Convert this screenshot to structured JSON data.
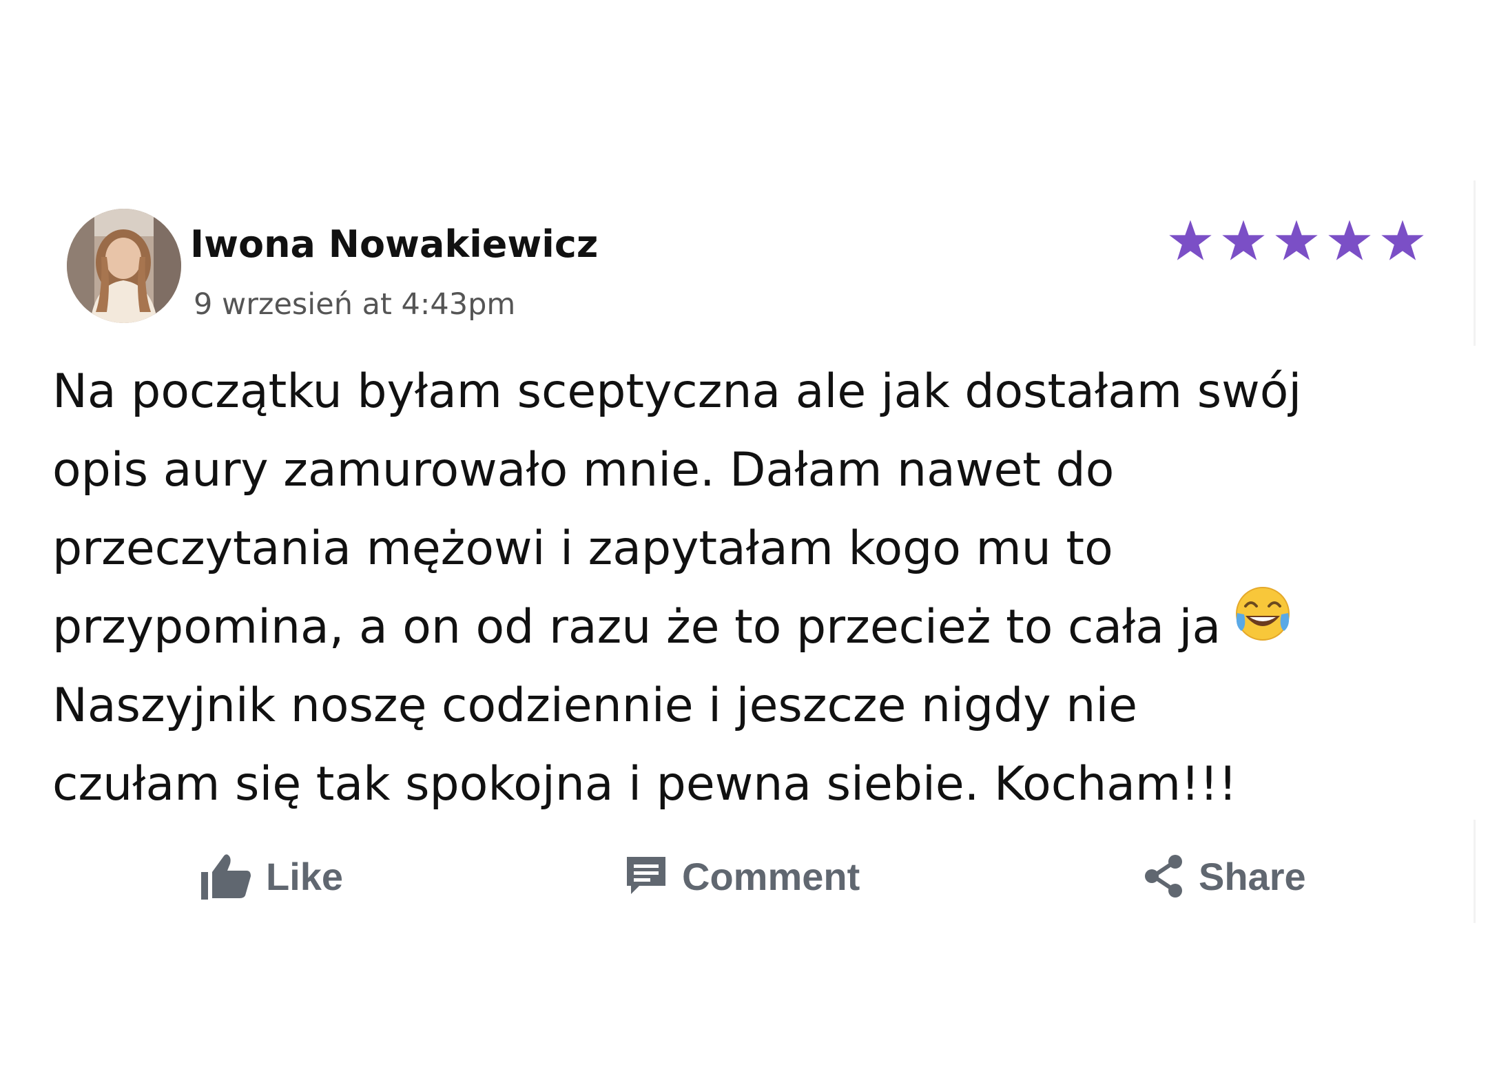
{
  "post": {
    "author": "Iwona Nowakiewicz",
    "timestamp": "9 wrzesień at 4:43pm",
    "rating": 5,
    "rating_max": 5,
    "star_color": "#7b4fc6",
    "avatar_icon": "avatar-photo",
    "text_lines": [
      "Na początku byłam sceptyczna ale jak dostałam swój",
      "opis aury zamurowało mnie. Dałam nawet do",
      "przeczytania mężowi i zapytałam kogo mu to",
      "przypomina, a on od razu że to przecież to cała ja",
      "Naszyjnik noszę codziennie i jeszcze nigdy nie",
      "czułam się tak spokojna i pewna siebie. Kocham!!!"
    ],
    "emoji_icon": "face-with-tears-of-joy-emoji"
  },
  "actions": {
    "like_label": "Like",
    "comment_label": "Comment",
    "share_label": "Share",
    "icon_color": "#606770"
  }
}
